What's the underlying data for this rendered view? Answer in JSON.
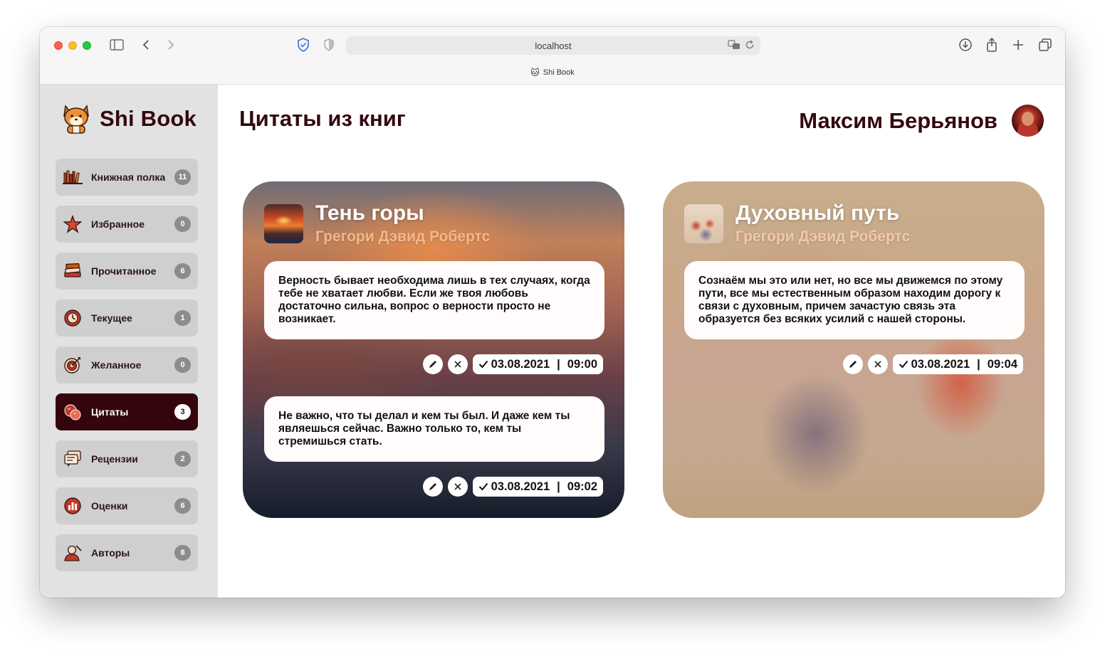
{
  "browser": {
    "url": "localhost",
    "tab_title": "Shi Book",
    "tab_favicon": "🐱"
  },
  "app": {
    "name": "Shi Book",
    "logo_icon": "shiba-dog-icon"
  },
  "sidebar": {
    "items": [
      {
        "label": "Книжная полка",
        "count": "11",
        "icon": "bookshelf-icon"
      },
      {
        "label": "Избранное",
        "count": "0",
        "icon": "star-icon"
      },
      {
        "label": "Прочитанное",
        "count": "6",
        "icon": "book-stack-icon"
      },
      {
        "label": "Текущее",
        "count": "1",
        "icon": "clock-target-icon"
      },
      {
        "label": "Желанное",
        "count": "0",
        "icon": "target-arrow-icon"
      },
      {
        "label": "Цитаты",
        "count": "3",
        "icon": "quotes-icon",
        "active": true
      },
      {
        "label": "Рецензии",
        "count": "2",
        "icon": "review-icon"
      },
      {
        "label": "Оценки",
        "count": "6",
        "icon": "rating-icon"
      },
      {
        "label": "Авторы",
        "count": "8",
        "icon": "author-icon"
      }
    ]
  },
  "main": {
    "title": "Цитаты из книг",
    "user_name": "Максим Берьянов"
  },
  "cards": [
    {
      "book_title": "Тень горы",
      "author": "Грегори Дэвид Робертс",
      "quotes": [
        {
          "text": "Верность бывает необходима лишь в тех случаях, когда тебе не хватает любви. Если же твоя любовь достаточно сильна, вопрос о верности просто не возникает.",
          "date": "03.08.2021",
          "time": "09:00"
        },
        {
          "text": "Не важно, что ты делал и кем ты был. И даже кем ты являешься сейчас. Важно только то, кем ты стремишься стать.",
          "date": "03.08.2021",
          "time": "09:02"
        }
      ]
    },
    {
      "book_title": "Духовный путь",
      "author": "Грегори Дэвид Робертс",
      "quotes": [
        {
          "text": "Сознаём мы это или нет, но все мы движемся по этому пути, все мы естественным образом находим дорогу к связи с духовным, причем зачастую связь эта образуется без всяких усилий с нашей стороны.",
          "date": "03.08.2021",
          "time": "09:04"
        }
      ]
    }
  ],
  "colors": {
    "brand": "#34080f",
    "sidebar_bg": "#e2e2e2",
    "nav_item_bg": "#cfcfcf",
    "nav_active_bg": "#34050d",
    "badge_bg": "#8c8c8c",
    "author_accent": "#f0b88c"
  }
}
